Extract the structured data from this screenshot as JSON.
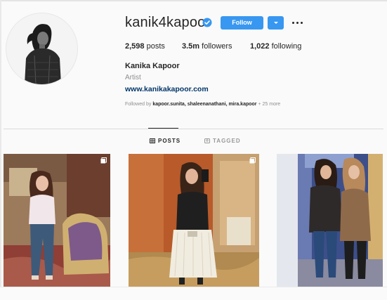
{
  "profile": {
    "username": "kanik4kapoor",
    "follow_label": "Follow",
    "stats": {
      "posts_count": "2,598",
      "posts_label": "posts",
      "followers_count": "3.5m",
      "followers_label": "followers",
      "following_count": "1,022",
      "following_label": "following"
    },
    "full_name": "Kanika Kapoor",
    "category": "Artist",
    "website": "www.kanikakapoor.com",
    "followed_by": {
      "prefix": "Followed by",
      "names": "kapoor.sunita, shaleenanathani, mira.kapoor",
      "more": "+ 25 more"
    }
  },
  "tabs": [
    {
      "label": "POSTS",
      "icon": "grid-icon",
      "active": true
    },
    {
      "label": "TAGGED",
      "icon": "tag-icon",
      "active": false
    }
  ],
  "photos": [
    {
      "name": "post-1",
      "icon": "multi-photo-icon"
    },
    {
      "name": "post-2",
      "icon": "multi-photo-icon"
    },
    {
      "name": "post-3"
    }
  ],
  "colors": {
    "accent": "#3897f0",
    "link": "#003569",
    "text": "#262626",
    "muted": "#8e8e8e",
    "background": "#fafafa"
  }
}
